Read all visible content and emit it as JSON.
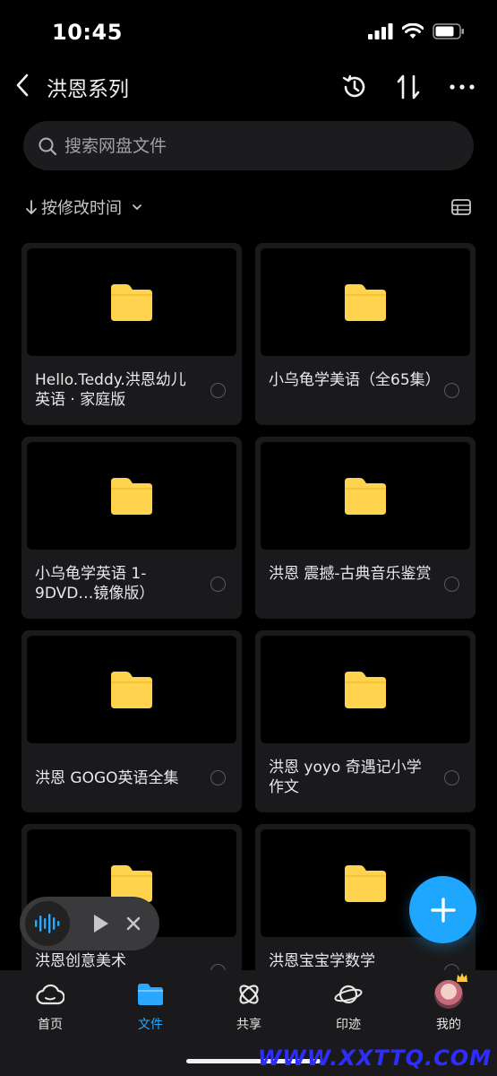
{
  "status": {
    "time": "10:45"
  },
  "nav": {
    "title": "洪恩系列"
  },
  "search": {
    "placeholder": "搜索网盘文件"
  },
  "sort": {
    "label": "按修改时间"
  },
  "folders": [
    {
      "name": "Hello.Teddy.洪恩幼儿英语 · 家庭版"
    },
    {
      "name": "小乌龟学美语（全65集）"
    },
    {
      "name": "小乌龟学英语 1-9DVD…镜像版）"
    },
    {
      "name": "洪恩 震撼-古典音乐鉴赏"
    },
    {
      "name": "洪恩 GOGO英语全集"
    },
    {
      "name": "洪恩 yoyo 奇遇记小学作文"
    },
    {
      "name": "洪恩创意美术"
    },
    {
      "name": "洪恩宝宝学数学"
    }
  ],
  "tabs": [
    {
      "label": "首页",
      "icon": "cloud-icon"
    },
    {
      "label": "文件",
      "icon": "folder-icon"
    },
    {
      "label": "共享",
      "icon": "share-icon"
    },
    {
      "label": "印迹",
      "icon": "planet-icon"
    },
    {
      "label": "我的",
      "icon": "avatar"
    }
  ],
  "watermark": "WWW.XXTTQ.COM",
  "colors": {
    "accent": "#2aa7ff",
    "folder": "#ffd34e",
    "background": "#000000",
    "card": "#1a1a1c"
  }
}
